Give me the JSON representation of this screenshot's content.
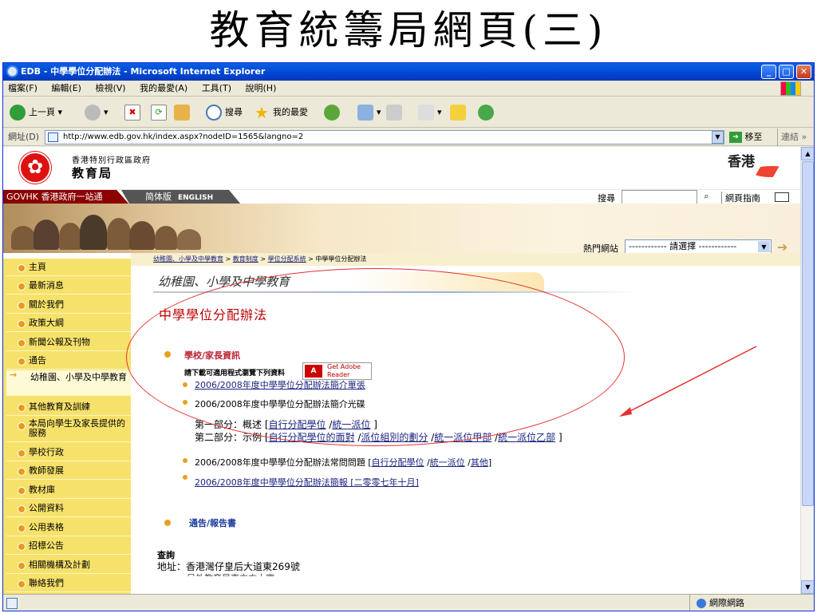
{
  "slide": {
    "title": "教育統籌局網頁(三)"
  },
  "window": {
    "title": "EDB - 中學學位分配辦法 - Microsoft Internet Explorer"
  },
  "menu": [
    "檔案(F)",
    "編輯(E)",
    "檢視(V)",
    "我的最愛(A)",
    "工具(T)",
    "說明(H)"
  ],
  "toolbar": {
    "back": "上一頁",
    "search": "搜尋",
    "favorites": "我的最愛"
  },
  "address": {
    "label": "網址(D)",
    "url": "http://www.edb.gov.hk/index.aspx?nodeID=1565&langno=2",
    "go": "移至",
    "links": "連結"
  },
  "page": {
    "gov_name": "香港特別行政區政府",
    "bureau_name": "教育局",
    "hk": "香港",
    "govhk": "GOVHK 香港政府一站通",
    "lang_sc": "简体版",
    "lang_en": "ENGLISH",
    "search_label": "搜尋",
    "sitemap": "網頁指南",
    "hot_label": "熱門網站",
    "hot_select": "------------ 請選擇 ------------"
  },
  "sidebar": [
    "主頁",
    "最新消息",
    "關於我們",
    "政策大綱",
    "新聞公報及刊物",
    "通告",
    "幼稚園、小學及中學教育",
    "其他教育及訓練",
    "本局向學生及家長提供的服務",
    "學校行政",
    "教師發展",
    "教材庫",
    "公開資料",
    "公用表格",
    "招標公告",
    "相關機構及計劃",
    "聯絡我們"
  ],
  "breadcrumb": {
    "links": [
      "幼稚園、小學及中學教育",
      "教育制度",
      "學位分配系統"
    ],
    "current": "中學學位分配辦法",
    "sep": " > "
  },
  "content": {
    "section_banner": "幼稚園、小學及中學教育",
    "heading": "中學學位分配辦法",
    "sec1_title": "學校/家長資訊",
    "viewer_note": "請下載可適用程式瀏覽下列資料",
    "reader_badge": "Get Adobe Reader",
    "item1": "2006/2008年度中學學位分配辦法簡介單張",
    "item2": "2006/2008年度中學學位分配辦法簡介光碟",
    "part1_label": "第一部分：概述 [",
    "part1_links": [
      "自行分配學位",
      "統一派位"
    ],
    "part2_label": "第二部分：示例 [",
    "part2_links": [
      "自行分配學位的面對",
      "派位組別的劃分",
      "統一派位甲部",
      "統一派位乙部"
    ],
    "item3_label": "2006/2008年度中學學位分配辦法常問問題 [",
    "item3_links": [
      "自行分配學位",
      "統一派位",
      "其他"
    ],
    "item4": "2006/2008年度中學學位分配辦法簡報 [二零零七年十月]",
    "sec2_title": "通告/報告書",
    "contact_title": "查詢",
    "contact_address": "地址：香港灣仔皇后大道東269號",
    "contact_more": "另外教育局東方方大廈"
  },
  "status": {
    "zone": "網際網路"
  }
}
